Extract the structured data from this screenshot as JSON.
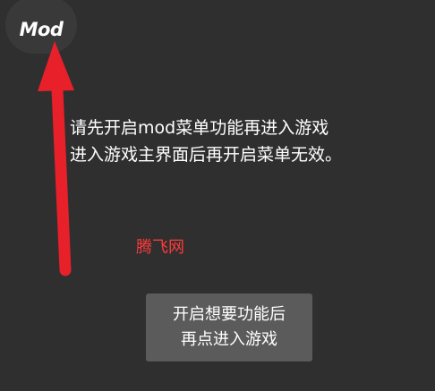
{
  "mod_button": {
    "label": "Mod"
  },
  "instructions": {
    "line1": "请先开启mod菜单功能再进入游戏",
    "line2": "进入游戏主界面后再开启菜单无效。"
  },
  "watermark": {
    "text": "腾飞网"
  },
  "toast": {
    "line1": "开启想要功能后",
    "line2": "再点进入游戏"
  },
  "colors": {
    "background": "#2f2f2f",
    "arrow": "#e8202a",
    "watermark": "#ff3a3a",
    "toast_background": "#5b5b5b"
  },
  "icons": {
    "arrow": "up-arrow-icon"
  }
}
